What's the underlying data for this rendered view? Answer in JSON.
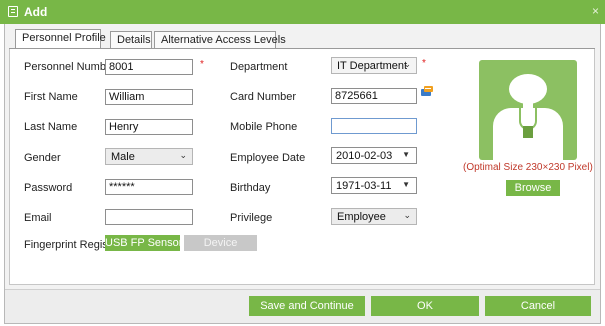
{
  "window": {
    "title": "Add",
    "close_glyph": "×"
  },
  "tabs": [
    {
      "label": "Personnel Profile",
      "active": true
    },
    {
      "label": "Details",
      "active": false
    },
    {
      "label": "Alternative Access Levels",
      "active": false
    }
  ],
  "form": {
    "personnel_number": {
      "label": "Personnel Number",
      "value": "8001",
      "required": true
    },
    "first_name": {
      "label": "First Name",
      "value": "William"
    },
    "last_name": {
      "label": "Last Name",
      "value": "Henry"
    },
    "gender": {
      "label": "Gender",
      "value": "Male"
    },
    "password": {
      "label": "Password",
      "value": "******"
    },
    "email": {
      "label": "Email",
      "value": ""
    },
    "fingerprint": {
      "label": "Fingerprint Registe",
      "usb_label": "USB FP Sensor",
      "device_label": "Device"
    },
    "department": {
      "label": "Department",
      "value": "IT Department",
      "required": true
    },
    "card_number": {
      "label": "Card Number",
      "value": "8725661"
    },
    "mobile_phone": {
      "label": "Mobile Phone",
      "value": ""
    },
    "employee_date": {
      "label": "Employee Date",
      "value": "2010-02-03"
    },
    "birthday": {
      "label": "Birthday",
      "value": "1971-03-11"
    },
    "privilege": {
      "label": "Privilege",
      "value": "Employee"
    },
    "required_mark": "*"
  },
  "photo": {
    "hint": "(Optimal Size 230×230 Pixel)",
    "browse_label": "Browse"
  },
  "footer": {
    "save_continue_label": "Save and Continue",
    "ok_label": "OK",
    "cancel_label": "Cancel"
  },
  "icons": {
    "window": "form-icon",
    "card": "card-reader-icon",
    "avatar": "person-silhouette-icon",
    "dropdown": "chevron-down-icon"
  },
  "colors": {
    "accent": "#78b747",
    "required": "#e02020",
    "hint": "#c0392b"
  }
}
